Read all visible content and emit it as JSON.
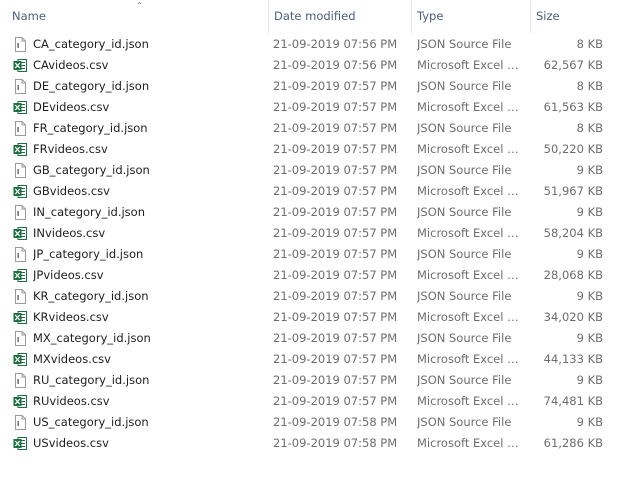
{
  "columns": {
    "name": "Name",
    "date": "Date modified",
    "type": "Type",
    "size": "Size"
  },
  "sort": {
    "column": "Name",
    "direction": "ascending",
    "icon": "chevron-up-icon"
  },
  "icons": {
    "json": "json-file-icon",
    "csv": "excel-csv-icon"
  },
  "colors": {
    "excel_green": "#1d6f42",
    "header_text": "#4c607a",
    "muted_text": "#6d6d6d"
  },
  "files": [
    {
      "name": "CA_category_id.json",
      "date": "21-09-2019 07:56 PM",
      "type": "JSON Source File",
      "size": "8 KB",
      "icon": "json"
    },
    {
      "name": "CAvideos.csv",
      "date": "21-09-2019 07:56 PM",
      "type": "Microsoft Excel C...",
      "size": "62,567 KB",
      "icon": "csv"
    },
    {
      "name": "DE_category_id.json",
      "date": "21-09-2019 07:57 PM",
      "type": "JSON Source File",
      "size": "8 KB",
      "icon": "json"
    },
    {
      "name": "DEvideos.csv",
      "date": "21-09-2019 07:57 PM",
      "type": "Microsoft Excel C...",
      "size": "61,563 KB",
      "icon": "csv"
    },
    {
      "name": "FR_category_id.json",
      "date": "21-09-2019 07:57 PM",
      "type": "JSON Source File",
      "size": "8 KB",
      "icon": "json"
    },
    {
      "name": "FRvideos.csv",
      "date": "21-09-2019 07:57 PM",
      "type": "Microsoft Excel C...",
      "size": "50,220 KB",
      "icon": "csv"
    },
    {
      "name": "GB_category_id.json",
      "date": "21-09-2019 07:57 PM",
      "type": "JSON Source File",
      "size": "9 KB",
      "icon": "json"
    },
    {
      "name": "GBvideos.csv",
      "date": "21-09-2019 07:57 PM",
      "type": "Microsoft Excel C...",
      "size": "51,967 KB",
      "icon": "csv"
    },
    {
      "name": "IN_category_id.json",
      "date": "21-09-2019 07:57 PM",
      "type": "JSON Source File",
      "size": "9 KB",
      "icon": "json"
    },
    {
      "name": "INvideos.csv",
      "date": "21-09-2019 07:57 PM",
      "type": "Microsoft Excel C...",
      "size": "58,204 KB",
      "icon": "csv"
    },
    {
      "name": "JP_category_id.json",
      "date": "21-09-2019 07:57 PM",
      "type": "JSON Source File",
      "size": "9 KB",
      "icon": "json"
    },
    {
      "name": "JPvideos.csv",
      "date": "21-09-2019 07:57 PM",
      "type": "Microsoft Excel C...",
      "size": "28,068 KB",
      "icon": "csv"
    },
    {
      "name": "KR_category_id.json",
      "date": "21-09-2019 07:57 PM",
      "type": "JSON Source File",
      "size": "9 KB",
      "icon": "json"
    },
    {
      "name": "KRvideos.csv",
      "date": "21-09-2019 07:57 PM",
      "type": "Microsoft Excel C...",
      "size": "34,020 KB",
      "icon": "csv"
    },
    {
      "name": "MX_category_id.json",
      "date": "21-09-2019 07:57 PM",
      "type": "JSON Source File",
      "size": "9 KB",
      "icon": "json"
    },
    {
      "name": "MXvideos.csv",
      "date": "21-09-2019 07:57 PM",
      "type": "Microsoft Excel C...",
      "size": "44,133 KB",
      "icon": "csv"
    },
    {
      "name": "RU_category_id.json",
      "date": "21-09-2019 07:57 PM",
      "type": "JSON Source File",
      "size": "9 KB",
      "icon": "json"
    },
    {
      "name": "RUvideos.csv",
      "date": "21-09-2019 07:57 PM",
      "type": "Microsoft Excel C...",
      "size": "74,481 KB",
      "icon": "csv"
    },
    {
      "name": "US_category_id.json",
      "date": "21-09-2019 07:58 PM",
      "type": "JSON Source File",
      "size": "9 KB",
      "icon": "json"
    },
    {
      "name": "USvideos.csv",
      "date": "21-09-2019 07:58 PM",
      "type": "Microsoft Excel C...",
      "size": "61,286 KB",
      "icon": "csv"
    }
  ]
}
